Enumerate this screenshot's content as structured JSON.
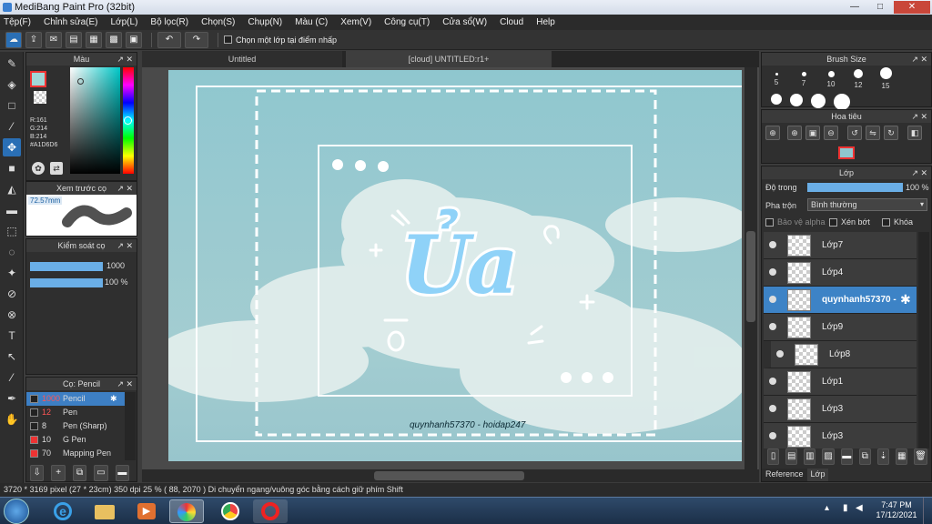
{
  "window": {
    "title": "MediBang Paint Pro (32bit)"
  },
  "menu": [
    "Tệp(F)",
    "Chỉnh sửa(E)",
    "Lớp(L)",
    "Bộ lọc(R)",
    "Chọn(S)",
    "Chụp(N)",
    "Màu (C)",
    "Xem(V)",
    "Công cụ(T)",
    "Cửa sổ(W)",
    "Cloud",
    "Help"
  ],
  "toolbar": {
    "select_layer_label": "Chọn một lớp tại điểm nhấp"
  },
  "color_panel": {
    "title": "Màu",
    "r": "R:161",
    "g": "G:214",
    "b": "B:214",
    "hex": "#A1D6D6",
    "main_color": "#A1D6D6"
  },
  "brush_preview_panel": {
    "title": "Xem trước cọ",
    "size": "72.57mm"
  },
  "brush_control_panel": {
    "title": "Kiểm soát cọ",
    "size_value": "1000",
    "opacity_value": "100 %"
  },
  "brush_list_panel": {
    "title": "Cọ: Pencil",
    "items": [
      {
        "size": "1000",
        "name": "Pencil",
        "color": "#222222"
      },
      {
        "size": "12",
        "name": "Pen",
        "color": "#222222"
      },
      {
        "size": "8",
        "name": "Pen (Sharp)",
        "color": "#222222"
      },
      {
        "size": "10",
        "name": "G Pen",
        "color": "#ee3333"
      },
      {
        "size": "70",
        "name": "Mapping Pen",
        "color": "#ee3333"
      }
    ]
  },
  "tabs": [
    "Untitled",
    "[cloud] UNTITLED:r1+"
  ],
  "artwork": {
    "title_text": "Ủa",
    "credit": "quynhanh57370 - hoidap247"
  },
  "brush_size_panel": {
    "title": "Brush Size",
    "sizes": [
      "5",
      "7",
      "10",
      "12",
      "15"
    ]
  },
  "navigator_panel": {
    "title": "Hoa tiêu"
  },
  "layer_panel": {
    "title": "Lớp",
    "opacity_label": "Độ trong",
    "opacity_value": "100 %",
    "blend_label": "Pha trộn",
    "blend_value": "Bình thường",
    "protect_alpha": "Bảo vệ alpha",
    "clipping": "Xén bớt",
    "lock": "Khóa",
    "layers": [
      {
        "name": "Lớp7",
        "selected": false,
        "indent": false
      },
      {
        "name": "Lớp4",
        "selected": false,
        "indent": false
      },
      {
        "name": "quynhanh57370 -",
        "selected": true,
        "indent": false
      },
      {
        "name": "Lớp9",
        "selected": false,
        "indent": false
      },
      {
        "name": "Lớp8",
        "selected": false,
        "indent": true
      },
      {
        "name": "Lớp1",
        "selected": false,
        "indent": false
      },
      {
        "name": "Lớp3",
        "selected": false,
        "indent": false
      },
      {
        "name": "Lớp3",
        "selected": false,
        "indent": false
      }
    ],
    "bottom_tabs": [
      "Reference",
      "Lớp"
    ]
  },
  "status": "3720 * 3169 pixel   (27 * 23cm)   350 dpi   25 %   ( 88, 2070 )   Di chuyển ngang/vuông góc bằng cách giữ phím Shift",
  "clock": {
    "time": "7:47 PM",
    "date": "17/12/2021"
  }
}
